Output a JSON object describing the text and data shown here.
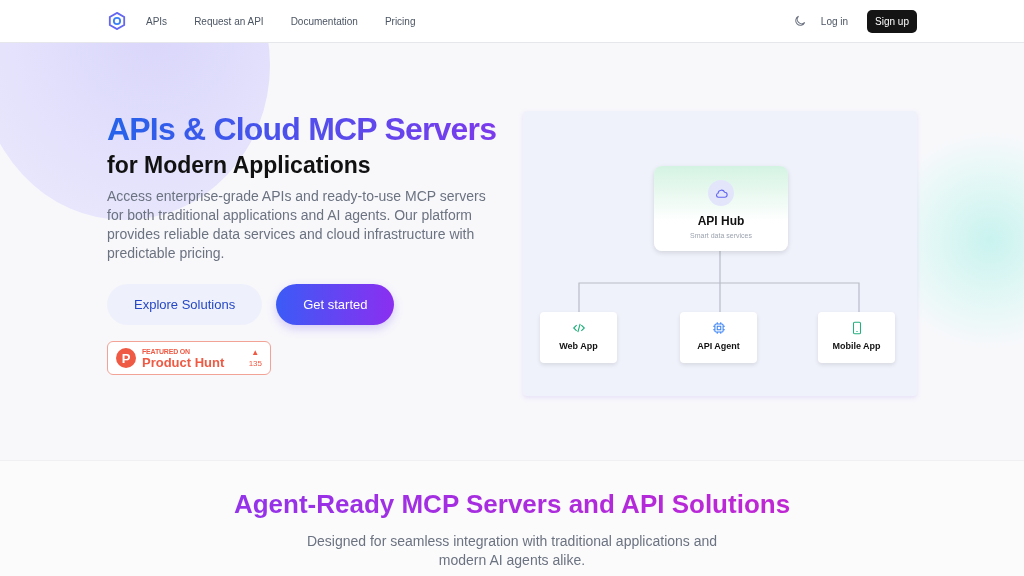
{
  "nav": {
    "links": [
      "APIs",
      "Request an API",
      "Documentation",
      "Pricing"
    ],
    "login": "Log in",
    "signup": "Sign up"
  },
  "hero": {
    "title": "APIs & Cloud MCP Servers",
    "subtitle": "for Modern Applications",
    "description": "Access enterprise-grade APIs and ready-to-use MCP servers for both traditional applications and AI agents. Our platform provides reliable data services and cloud infrastructure with predictable pricing.",
    "buttons": [
      {
        "label": "Explore Solutions",
        "kind": "secondary"
      },
      {
        "label": "Get started",
        "kind": "primary"
      }
    ],
    "badge": {
      "featured": "FEATURED ON",
      "name": "Product Hunt",
      "letter": "P",
      "arrow": "▲",
      "count": "135"
    }
  },
  "diagram": {
    "hub": {
      "title": "API Hub",
      "caption": "Smart data services"
    },
    "nodes": [
      {
        "label": "Web App",
        "kind": "code"
      },
      {
        "label": "API Agent",
        "kind": "chip"
      },
      {
        "label": "Mobile App",
        "kind": "phone"
      }
    ]
  },
  "section": {
    "title": "Agent-Ready MCP Servers and API Solutions",
    "description": "Designed for seamless integration with traditional applications and modern AI agents alike."
  }
}
